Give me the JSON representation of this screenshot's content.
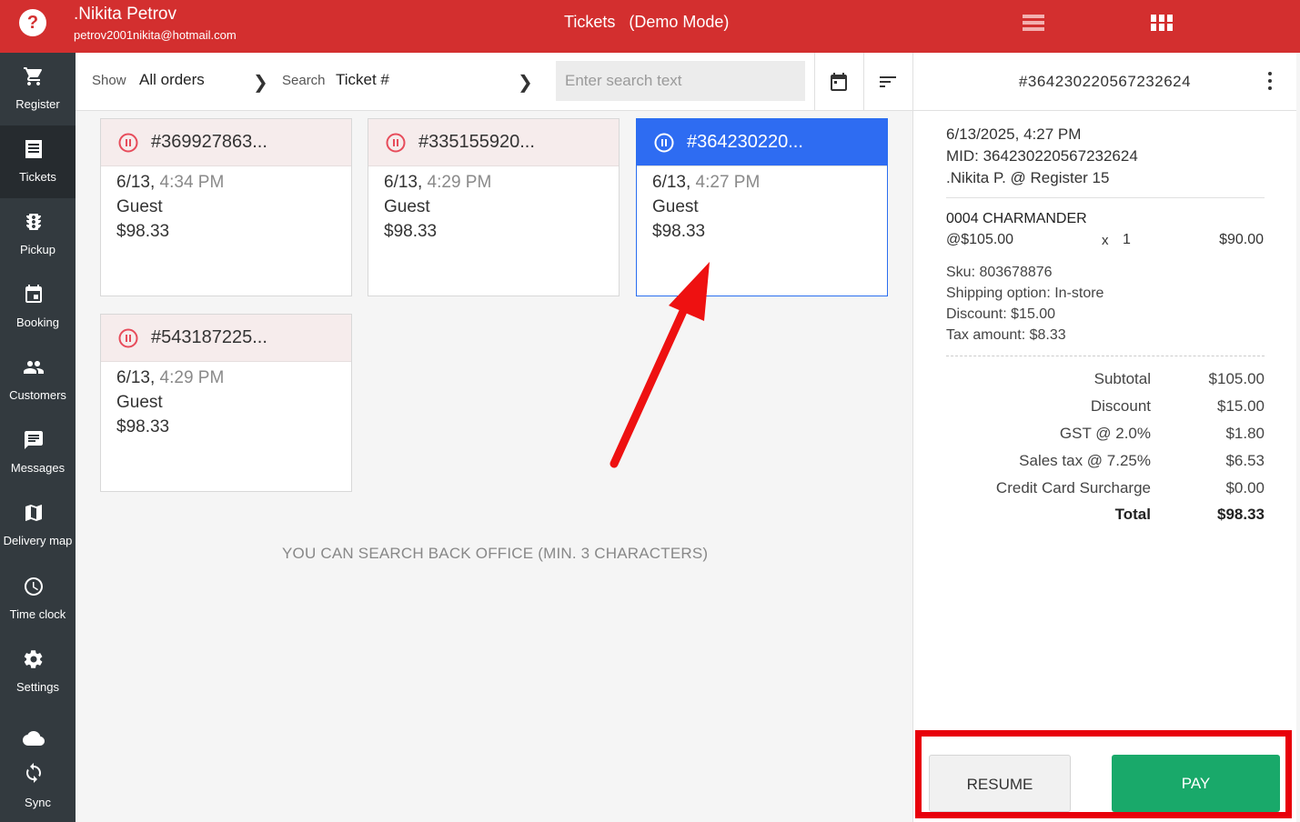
{
  "header": {
    "user_name": ".Nikita Petrov",
    "user_email": "petrov2001nikita@hotmail.com",
    "title": "Tickets",
    "mode": "(Demo Mode)"
  },
  "sidebar": {
    "items": [
      {
        "label": "Register",
        "icon": "cart-icon"
      },
      {
        "label": "Tickets",
        "icon": "receipt-icon",
        "active": true
      },
      {
        "label": "Pickup",
        "icon": "traffic-light-icon"
      },
      {
        "label": "Booking",
        "icon": "calendar-icon"
      },
      {
        "label": "Customers",
        "icon": "people-icon"
      },
      {
        "label": "Messages",
        "icon": "message-icon"
      },
      {
        "label": "Delivery map",
        "icon": "map-icon"
      },
      {
        "label": "Time clock",
        "icon": "clock-icon"
      },
      {
        "label": "Settings",
        "icon": "gear-icon"
      },
      {
        "label": "Sync",
        "icon": "sync-icon"
      }
    ]
  },
  "toolbar": {
    "show_label": "Show",
    "show_value": "All orders",
    "search_label": "Search",
    "search_value": "Ticket #",
    "search_placeholder": "Enter search text"
  },
  "tickets": [
    {
      "id": "#369927863...",
      "date": "6/13,",
      "time": "4:34 PM",
      "customer": "Guest",
      "amount": "$98.33",
      "selected": false
    },
    {
      "id": "#335155920...",
      "date": "6/13,",
      "time": "4:29 PM",
      "customer": "Guest",
      "amount": "$98.33",
      "selected": false
    },
    {
      "id": "#364230220...",
      "date": "6/13,",
      "time": "4:27 PM",
      "customer": "Guest",
      "amount": "$98.33",
      "selected": true
    },
    {
      "id": "#543187225...",
      "date": "6/13,",
      "time": "4:29 PM",
      "customer": "Guest",
      "amount": "$98.33",
      "selected": false
    }
  ],
  "info_message": "YOU CAN SEARCH BACK OFFICE (MIN. 3 CHARACTERS)",
  "detail": {
    "ticket_id": "#364230220567232624",
    "datetime": "6/13/2025, 4:27 PM",
    "mid": "MID: 364230220567232624",
    "register": ".Nikita P. @ Register 15",
    "item": {
      "name": "0004 CHARMANDER",
      "unit_price": "@$105.00",
      "x": "x",
      "qty": "1",
      "total": "$90.00",
      "sku": "Sku: 803678876",
      "shipping": "Shipping option: In-store",
      "discount": "Discount: $15.00",
      "tax": "Tax amount: $8.33"
    },
    "summary": [
      {
        "label": "Subtotal",
        "value": "$105.00"
      },
      {
        "label": "Discount",
        "value": "$15.00"
      },
      {
        "label": "GST @ 2.0%",
        "value": "$1.80"
      },
      {
        "label": "Sales tax @ 7.25%",
        "value": "$6.53"
      },
      {
        "label": "Credit Card Surcharge",
        "value": "$0.00"
      },
      {
        "label": "Total",
        "value": "$98.33"
      }
    ],
    "resume_label": "RESUME",
    "pay_label": "PAY"
  },
  "colors": {
    "header": "#d32f2f",
    "sidebar": "#333a3f",
    "selected": "#2e6cf2",
    "pay": "#19a96a",
    "annotation": "#e8000b"
  }
}
